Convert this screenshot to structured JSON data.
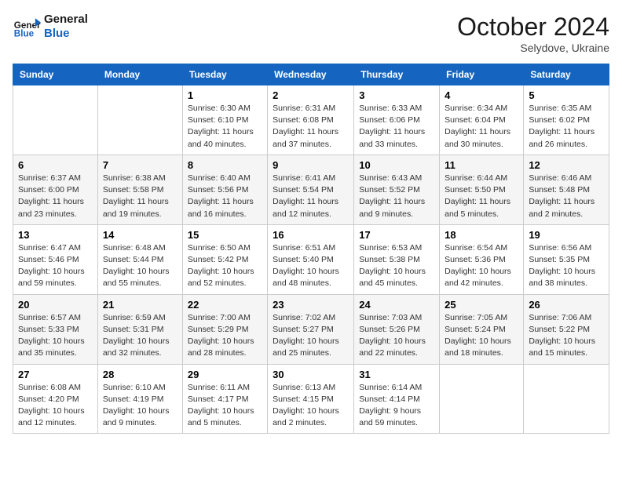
{
  "header": {
    "logo_line1": "General",
    "logo_line2": "Blue",
    "month": "October 2024",
    "location": "Selydove, Ukraine"
  },
  "weekdays": [
    "Sunday",
    "Monday",
    "Tuesday",
    "Wednesday",
    "Thursday",
    "Friday",
    "Saturday"
  ],
  "weeks": [
    [
      {
        "day": "",
        "info": ""
      },
      {
        "day": "",
        "info": ""
      },
      {
        "day": "1",
        "info": "Sunrise: 6:30 AM\nSunset: 6:10 PM\nDaylight: 11 hours and 40 minutes."
      },
      {
        "day": "2",
        "info": "Sunrise: 6:31 AM\nSunset: 6:08 PM\nDaylight: 11 hours and 37 minutes."
      },
      {
        "day": "3",
        "info": "Sunrise: 6:33 AM\nSunset: 6:06 PM\nDaylight: 11 hours and 33 minutes."
      },
      {
        "day": "4",
        "info": "Sunrise: 6:34 AM\nSunset: 6:04 PM\nDaylight: 11 hours and 30 minutes."
      },
      {
        "day": "5",
        "info": "Sunrise: 6:35 AM\nSunset: 6:02 PM\nDaylight: 11 hours and 26 minutes."
      }
    ],
    [
      {
        "day": "6",
        "info": "Sunrise: 6:37 AM\nSunset: 6:00 PM\nDaylight: 11 hours and 23 minutes."
      },
      {
        "day": "7",
        "info": "Sunrise: 6:38 AM\nSunset: 5:58 PM\nDaylight: 11 hours and 19 minutes."
      },
      {
        "day": "8",
        "info": "Sunrise: 6:40 AM\nSunset: 5:56 PM\nDaylight: 11 hours and 16 minutes."
      },
      {
        "day": "9",
        "info": "Sunrise: 6:41 AM\nSunset: 5:54 PM\nDaylight: 11 hours and 12 minutes."
      },
      {
        "day": "10",
        "info": "Sunrise: 6:43 AM\nSunset: 5:52 PM\nDaylight: 11 hours and 9 minutes."
      },
      {
        "day": "11",
        "info": "Sunrise: 6:44 AM\nSunset: 5:50 PM\nDaylight: 11 hours and 5 minutes."
      },
      {
        "day": "12",
        "info": "Sunrise: 6:46 AM\nSunset: 5:48 PM\nDaylight: 11 hours and 2 minutes."
      }
    ],
    [
      {
        "day": "13",
        "info": "Sunrise: 6:47 AM\nSunset: 5:46 PM\nDaylight: 10 hours and 59 minutes."
      },
      {
        "day": "14",
        "info": "Sunrise: 6:48 AM\nSunset: 5:44 PM\nDaylight: 10 hours and 55 minutes."
      },
      {
        "day": "15",
        "info": "Sunrise: 6:50 AM\nSunset: 5:42 PM\nDaylight: 10 hours and 52 minutes."
      },
      {
        "day": "16",
        "info": "Sunrise: 6:51 AM\nSunset: 5:40 PM\nDaylight: 10 hours and 48 minutes."
      },
      {
        "day": "17",
        "info": "Sunrise: 6:53 AM\nSunset: 5:38 PM\nDaylight: 10 hours and 45 minutes."
      },
      {
        "day": "18",
        "info": "Sunrise: 6:54 AM\nSunset: 5:36 PM\nDaylight: 10 hours and 42 minutes."
      },
      {
        "day": "19",
        "info": "Sunrise: 6:56 AM\nSunset: 5:35 PM\nDaylight: 10 hours and 38 minutes."
      }
    ],
    [
      {
        "day": "20",
        "info": "Sunrise: 6:57 AM\nSunset: 5:33 PM\nDaylight: 10 hours and 35 minutes."
      },
      {
        "day": "21",
        "info": "Sunrise: 6:59 AM\nSunset: 5:31 PM\nDaylight: 10 hours and 32 minutes."
      },
      {
        "day": "22",
        "info": "Sunrise: 7:00 AM\nSunset: 5:29 PM\nDaylight: 10 hours and 28 minutes."
      },
      {
        "day": "23",
        "info": "Sunrise: 7:02 AM\nSunset: 5:27 PM\nDaylight: 10 hours and 25 minutes."
      },
      {
        "day": "24",
        "info": "Sunrise: 7:03 AM\nSunset: 5:26 PM\nDaylight: 10 hours and 22 minutes."
      },
      {
        "day": "25",
        "info": "Sunrise: 7:05 AM\nSunset: 5:24 PM\nDaylight: 10 hours and 18 minutes."
      },
      {
        "day": "26",
        "info": "Sunrise: 7:06 AM\nSunset: 5:22 PM\nDaylight: 10 hours and 15 minutes."
      }
    ],
    [
      {
        "day": "27",
        "info": "Sunrise: 6:08 AM\nSunset: 4:20 PM\nDaylight: 10 hours and 12 minutes."
      },
      {
        "day": "28",
        "info": "Sunrise: 6:10 AM\nSunset: 4:19 PM\nDaylight: 10 hours and 9 minutes."
      },
      {
        "day": "29",
        "info": "Sunrise: 6:11 AM\nSunset: 4:17 PM\nDaylight: 10 hours and 5 minutes."
      },
      {
        "day": "30",
        "info": "Sunrise: 6:13 AM\nSunset: 4:15 PM\nDaylight: 10 hours and 2 minutes."
      },
      {
        "day": "31",
        "info": "Sunrise: 6:14 AM\nSunset: 4:14 PM\nDaylight: 9 hours and 59 minutes."
      },
      {
        "day": "",
        "info": ""
      },
      {
        "day": "",
        "info": ""
      }
    ]
  ]
}
